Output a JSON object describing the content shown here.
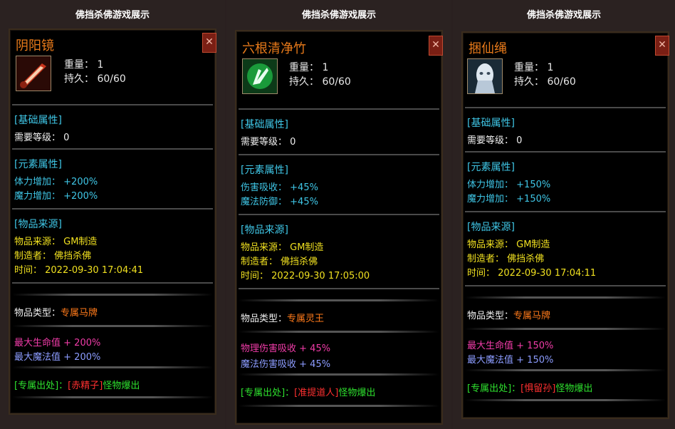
{
  "panels": [
    {
      "header": "佛挡杀佛游戏展示",
      "name": "阴阳镜",
      "weight_label": "重量：",
      "weight": "1",
      "durability_label": "持久：",
      "durability": "60/60",
      "basic_title": "[基础属性]",
      "level_req": "需要等级： 0",
      "element_title": "[元素属性]",
      "elem1_label": "体力增加：",
      "elem1_value": "+200%",
      "elem2_label": "魔力增加：",
      "elem2_value": "+200%",
      "source_title": "[物品来源]",
      "source": "物品来源： GM制造",
      "maker": "制造者： 佛挡杀佛",
      "time": "时间： 2022-09-30 17:04:41",
      "type_label": "物品类型：",
      "type_value": "专属马牌",
      "bonus1_label": "最大生命值",
      "bonus1_value": "+ 200%",
      "bonus2_label": "最大魔法值",
      "bonus2_value": "+ 200%",
      "drop_prefix": "[专属出处]：",
      "drop_monster": "[赤精子]",
      "drop_suffix": "怪物爆出",
      "icon": "sword-icon"
    },
    {
      "header": "佛挡杀佛游戏展示",
      "name": "六根清净竹",
      "weight_label": "重量：",
      "weight": "1",
      "durability_label": "持久：",
      "durability": "60/60",
      "basic_title": "[基础属性]",
      "level_req": "需要等级： 0",
      "element_title": "[元素属性]",
      "elem1_label": "伤害吸收：",
      "elem1_value": "+45%",
      "elem2_label": "魔法防御：",
      "elem2_value": "+45%",
      "source_title": "[物品来源]",
      "source": "物品来源： GM制造",
      "maker": "制造者： 佛挡杀佛",
      "time": "时间： 2022-09-30 17:05:00",
      "type_label": "物品类型：",
      "type_value": "专属灵王",
      "bonus1_label": "物理伤害吸收",
      "bonus1_value": "+ 45%",
      "bonus2_label": "魔法伤害吸收",
      "bonus2_value": "+ 45%",
      "drop_prefix": "[专属出处]：",
      "drop_monster": "[准提道人]",
      "drop_suffix": "怪物爆出",
      "icon": "green-hand-icon"
    },
    {
      "header": "佛挡杀佛游戏展示",
      "name": "捆仙绳",
      "weight_label": "重量：",
      "weight": "1",
      "durability_label": "持久：",
      "durability": "60/60",
      "basic_title": "[基础属性]",
      "level_req": "需要等级： 0",
      "element_title": "[元素属性]",
      "elem1_label": "体力增加：",
      "elem1_value": "+150%",
      "elem2_label": "魔力增加：",
      "elem2_value": "+150%",
      "source_title": "[物品来源]",
      "source": "物品来源： GM制造",
      "maker": "制造者： 佛挡杀佛",
      "time": "时间： 2022-09-30 17:04:11",
      "type_label": "物品类型：",
      "type_value": "专属马牌",
      "bonus1_label": "最大生命值",
      "bonus1_value": "+ 150%",
      "bonus2_label": "最大魔法值",
      "bonus2_value": "+ 150%",
      "drop_prefix": "[专属出处]：",
      "drop_monster": "[惧留孙]",
      "drop_suffix": "怪物爆出",
      "icon": "ghost-face-icon"
    }
  ]
}
